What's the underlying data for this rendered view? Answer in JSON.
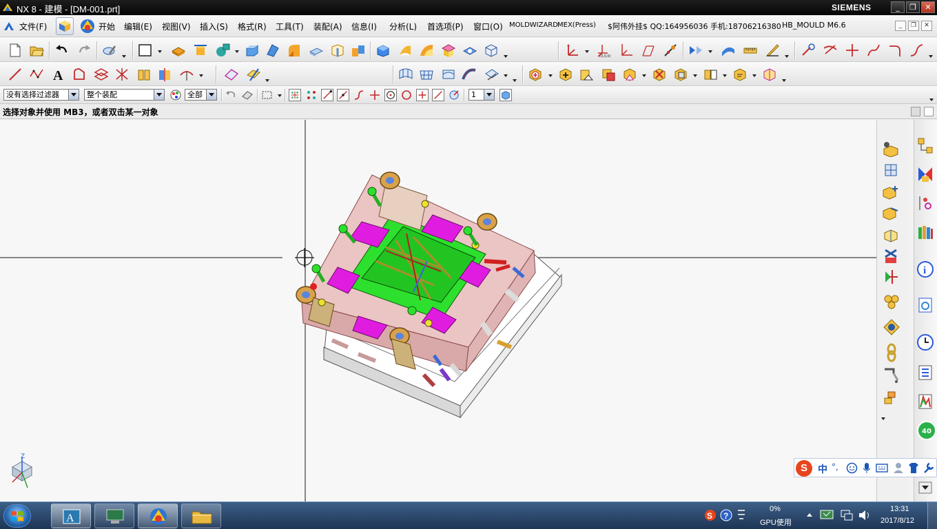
{
  "window": {
    "title": "NX 8 - 建模 - [DM-001.prt]",
    "brand": "SIEMENS",
    "controls": {
      "minimize": "_",
      "restore": "❐",
      "close": "✕"
    }
  },
  "menubar": {
    "items": [
      {
        "label": "文件(F)"
      },
      {
        "label": "开始"
      },
      {
        "label": "编辑(E)"
      },
      {
        "label": "视图(V)"
      },
      {
        "label": "插入(S)"
      },
      {
        "label": "格式(R)"
      },
      {
        "label": "工具(T)"
      },
      {
        "label": "装配(A)"
      },
      {
        "label": "信息(I)"
      },
      {
        "label": "分析(L)"
      },
      {
        "label": "首选项(P)"
      },
      {
        "label": "窗口(O)"
      },
      {
        "label": "MOLDWIZARD"
      },
      {
        "label": "MEX(Press)"
      },
      {
        "label": "$阿伟外挂$ QQ:164956036 手机:18706216380"
      },
      {
        "label": "HB_MOULD M6.6"
      }
    ],
    "mdi": {
      "minimize": "_",
      "restore": "❐",
      "close": "✕"
    }
  },
  "selection_bar": {
    "type_filter": "没有选择过滤器",
    "scope": "整个装配",
    "layer_filter": "全部",
    "count": "1"
  },
  "cue_line": {
    "text": "选择对象并使用 MB3，或者双击某一对象"
  },
  "graphics": {
    "view_triad": {
      "axis_z": "Z"
    }
  },
  "ime": {
    "logo": "S",
    "mode": "中",
    "punct": "°,"
  },
  "resource_bar": {
    "badge": "40"
  },
  "taskbar": {
    "gpu_percent": "0%",
    "gpu_label": "GPU使用",
    "time": "13:31",
    "date": "2017/8/12"
  },
  "colors": {
    "title_bg": "#0b0b0b",
    "graphics_bg": "#f7f7f7",
    "mold_plate": "#e9bcbc",
    "insert_green": "#2ce62c",
    "pad_magenta": "#e21ce2",
    "guide_gold": "#c8a050",
    "taskbar": "#2a4a70"
  }
}
